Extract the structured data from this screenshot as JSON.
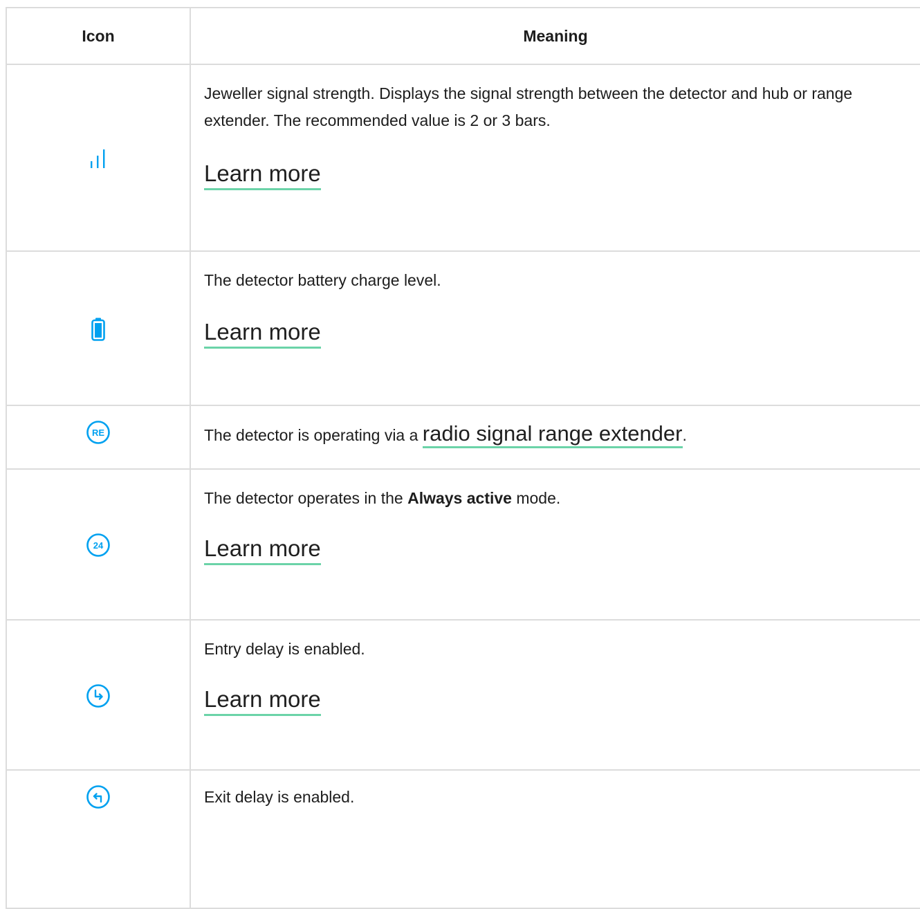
{
  "table": {
    "headers": {
      "icon": "Icon",
      "meaning": "Meaning"
    },
    "rows": [
      {
        "icon": "signal-bars-icon",
        "text": "Jeweller signal strength. Displays the signal strength between the detector and hub or range extender. The recommended value is 2 or 3 bars.",
        "link": "Learn more"
      },
      {
        "icon": "battery-icon",
        "text": "The detector battery charge level.",
        "link": "Learn more"
      },
      {
        "icon": "range-extender-icon",
        "text_before": "The detector is operating via a ",
        "link": "radio signal range extender",
        "text_after": "."
      },
      {
        "icon": "always-active-24-icon",
        "text_before": "The detector operates in the ",
        "bold": "Always active",
        "text_after": " mode.",
        "link": "Learn more"
      },
      {
        "icon": "entry-delay-icon",
        "text": "Entry delay is enabled.",
        "link": "Learn more"
      },
      {
        "icon": "exit-delay-icon",
        "text": "Exit delay is enabled."
      }
    ]
  },
  "icon_labels": {
    "range_extender": "RE",
    "always_active": "24"
  },
  "colors": {
    "icon": "#00a1f0",
    "link_underline": "#6bd3a8",
    "border": "#dcdcdc",
    "text": "#1d1d1d"
  }
}
